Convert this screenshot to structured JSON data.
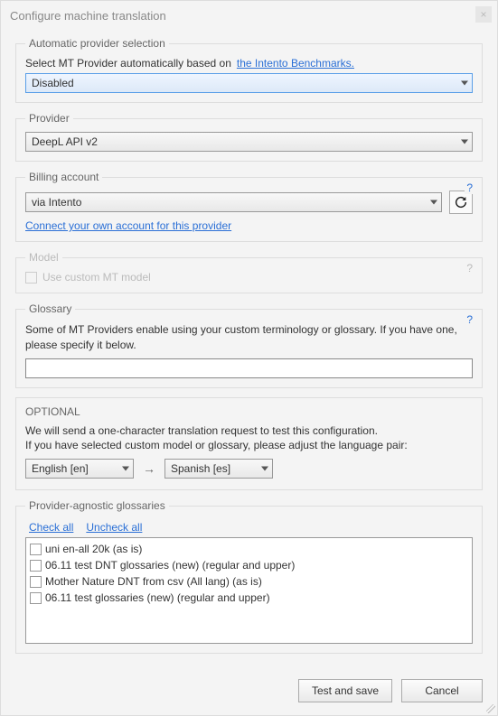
{
  "window": {
    "title": "Configure machine translation"
  },
  "auto_provider": {
    "legend": "Automatic provider selection",
    "label": "Select MT Provider automatically based on",
    "link_text": "the Intento Benchmarks.",
    "selected": "Disabled"
  },
  "provider": {
    "legend": "Provider",
    "selected": "DeepL API v2"
  },
  "billing": {
    "legend": "Billing account",
    "selected": "via Intento",
    "connect_link": "Connect your own account for this provider"
  },
  "model": {
    "legend": "Model",
    "checkbox_label": "Use custom MT model"
  },
  "glossary": {
    "legend": "Glossary",
    "desc": "Some of MT Providers enable using your custom terminology or glossary. If you have one, please specify it below."
  },
  "optional": {
    "header": "OPTIONAL",
    "line1": "We will send a one-character translation request to test this configuration.",
    "line2": "If you have selected custom model or glossary, please adjust the language pair:",
    "source_lang": "English [en]",
    "target_lang": "Spanish [es]"
  },
  "pa_glossaries": {
    "legend": "Provider-agnostic glossaries",
    "check_all": "Check all",
    "uncheck_all": "Uncheck all",
    "items": [
      "uni en-all 20k (as is)",
      "06.11 test DNT glossaries (new) (regular and upper)",
      "Mother Nature DNT from csv (All lang) (as is)",
      "06.11 test glossaries (new) (regular and upper)"
    ]
  },
  "buttons": {
    "test_save": "Test and save",
    "cancel": "Cancel"
  }
}
